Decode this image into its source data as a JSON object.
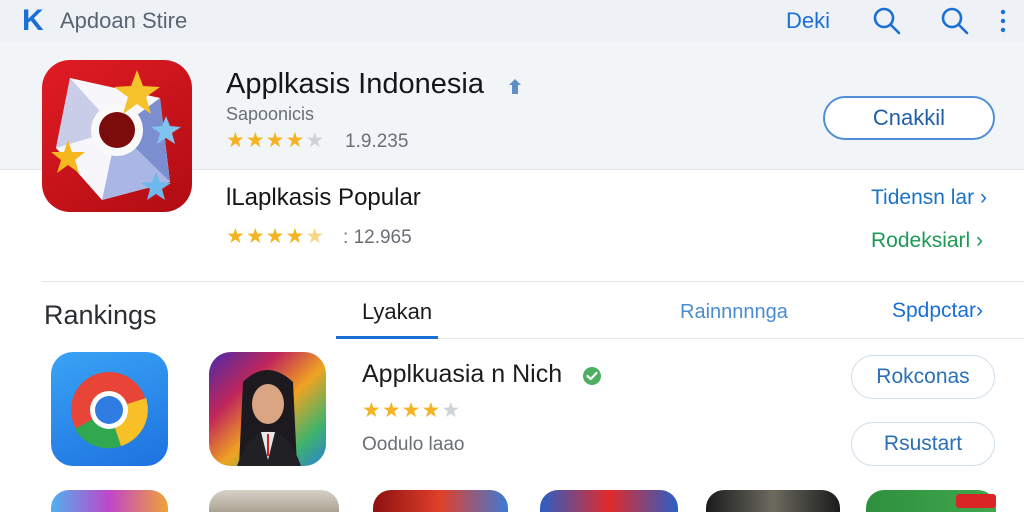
{
  "header": {
    "back_glyph": "K",
    "store_title": "Apdoan Stire",
    "right_link": "Deki",
    "icons": [
      "search-icon",
      "search-icon",
      "more-vertical-icon"
    ]
  },
  "app": {
    "title": "Applkasis Indonesia",
    "developer": "Sapoonicis",
    "rating_count": "1.9.235",
    "action_label": "Cnakkil"
  },
  "popular": {
    "title": "lLaplkasis Popular",
    "rating_count": "12.965",
    "link_blue": "Tidensn lar ›",
    "link_green": "Rodeksiarl ›"
  },
  "rankings": {
    "title": "Rankings",
    "tabs": [
      "Lyakan",
      "Rainnnnnga"
    ],
    "see_all": "Spdpctar›"
  },
  "ranked_app": {
    "title": "Applkuasia n Nich",
    "subtitle": "Oodulo laao",
    "button_1": "Rokconas",
    "button_2": "Rsustart"
  },
  "colors": {
    "accent": "#1a6fd6",
    "star": "#f3b323",
    "green_link": "#1c9a56",
    "hero_icon": "#e11c24"
  }
}
